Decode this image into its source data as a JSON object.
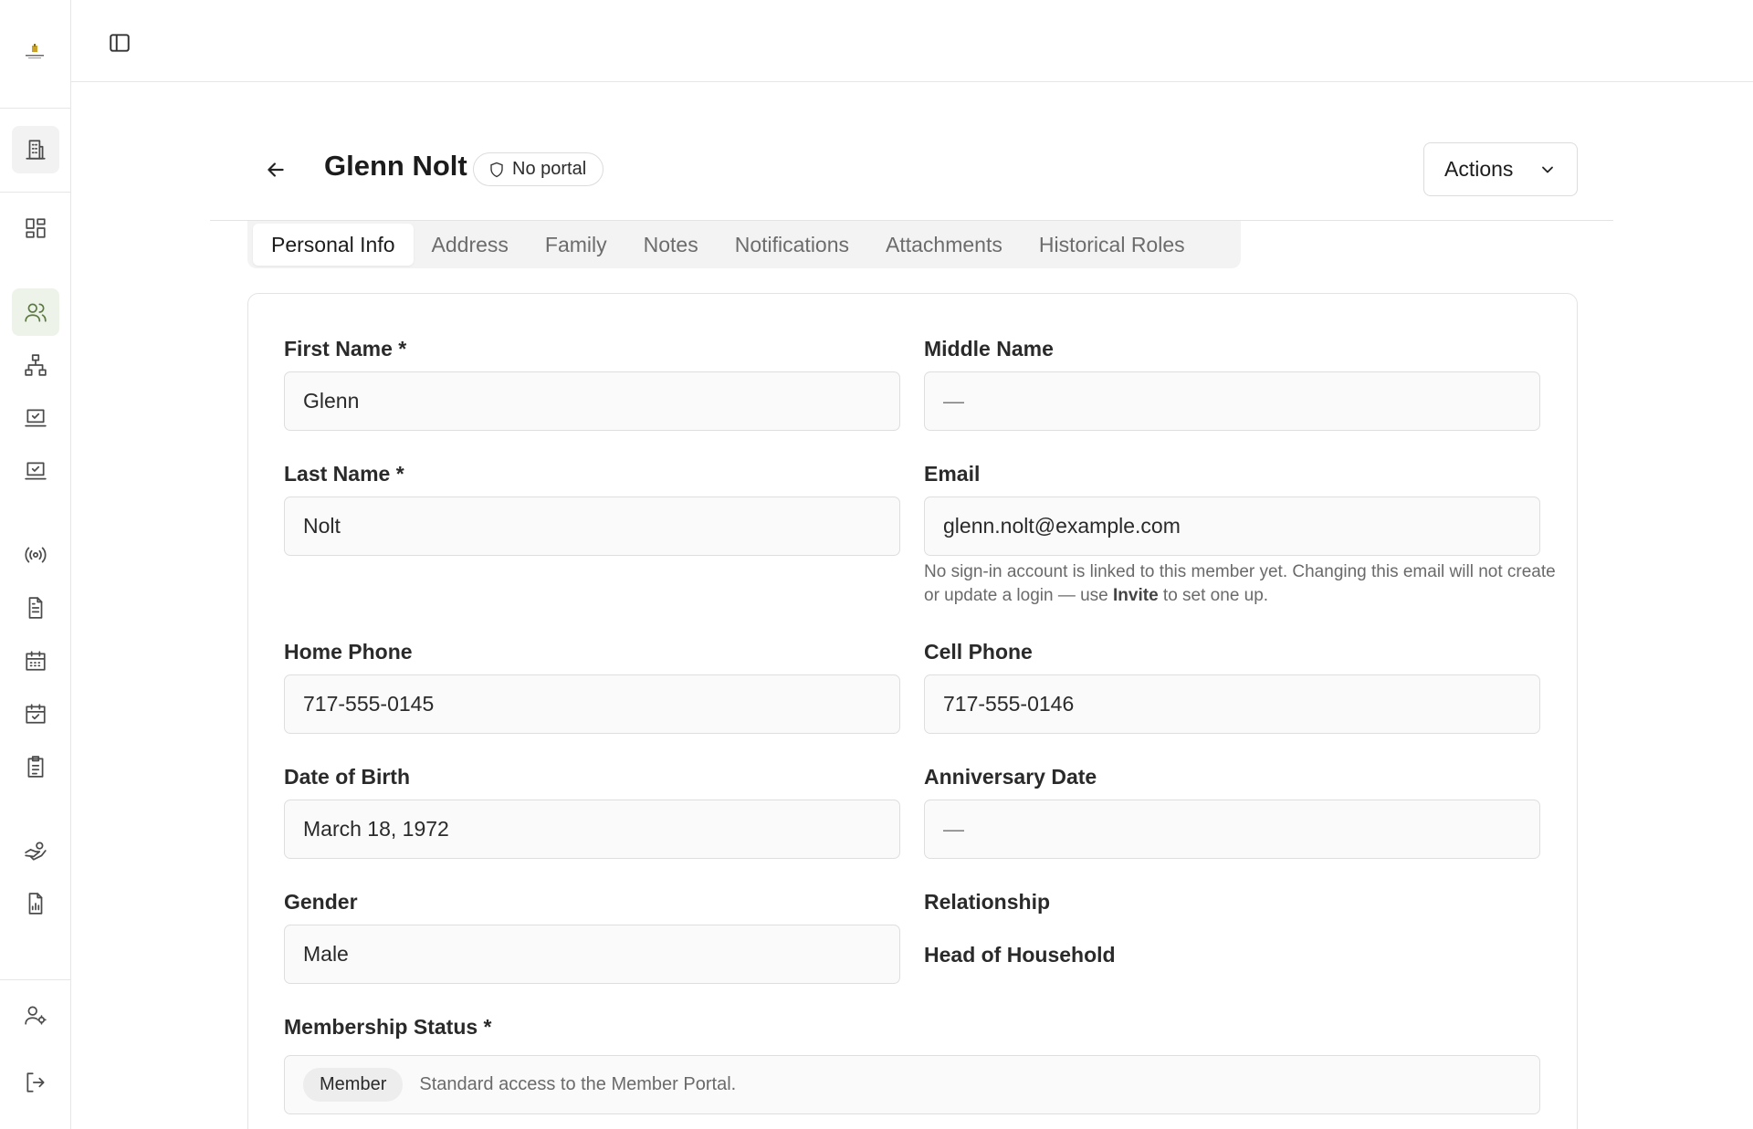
{
  "header": {
    "title": "Glenn Nolt",
    "portal_badge": "No portal",
    "actions_label": "Actions"
  },
  "tabs": [
    {
      "label": "Personal Info",
      "active": true
    },
    {
      "label": "Address"
    },
    {
      "label": "Family"
    },
    {
      "label": "Notes"
    },
    {
      "label": "Notifications"
    },
    {
      "label": "Attachments"
    },
    {
      "label": "Historical Roles"
    }
  ],
  "form": {
    "first_name": {
      "label": "First Name *",
      "value": "Glenn"
    },
    "middle_name": {
      "label": "Middle Name",
      "value": "—"
    },
    "last_name": {
      "label": "Last Name *",
      "value": "Nolt"
    },
    "email": {
      "label": "Email",
      "value": "glenn.nolt@example.com",
      "helper_before": "No sign-in account is linked to this member yet. Changing this email will not create or update a login — use ",
      "helper_bold": "Invite",
      "helper_after": " to set one up."
    },
    "home_phone": {
      "label": "Home Phone",
      "value": "717-555-0145"
    },
    "cell_phone": {
      "label": "Cell Phone",
      "value": "717-555-0146"
    },
    "date_of_birth": {
      "label": "Date of Birth",
      "value": "March 18, 1972"
    },
    "anniversary_date": {
      "label": "Anniversary Date",
      "value": "—"
    },
    "gender": {
      "label": "Gender",
      "value": "Male"
    },
    "relationship": {
      "label": "Relationship",
      "value": "Head of Household"
    },
    "membership_status": {
      "label": "Membership Status *",
      "value": "Member",
      "description": "Standard access to the Member Portal."
    }
  },
  "sidebar": {
    "items": [
      {
        "icon": "building-icon"
      },
      {
        "icon": "dashboard-icon"
      },
      {
        "icon": "users-icon",
        "selected": true
      },
      {
        "icon": "org-chart-icon"
      },
      {
        "icon": "laptop-check-icon"
      },
      {
        "icon": "laptop-check-icon"
      },
      {
        "icon": "broadcast-icon"
      },
      {
        "icon": "document-icon"
      },
      {
        "icon": "calendar-icon"
      },
      {
        "icon": "calendar-check-icon"
      },
      {
        "icon": "clipboard-icon"
      },
      {
        "icon": "hand-coins-icon"
      },
      {
        "icon": "report-icon"
      },
      {
        "icon": "user-settings-icon"
      },
      {
        "icon": "logout-icon"
      }
    ]
  },
  "colors": {
    "accent": "#5a7a3e",
    "border": "#e3e3e3",
    "input_bg": "#fafafa"
  }
}
